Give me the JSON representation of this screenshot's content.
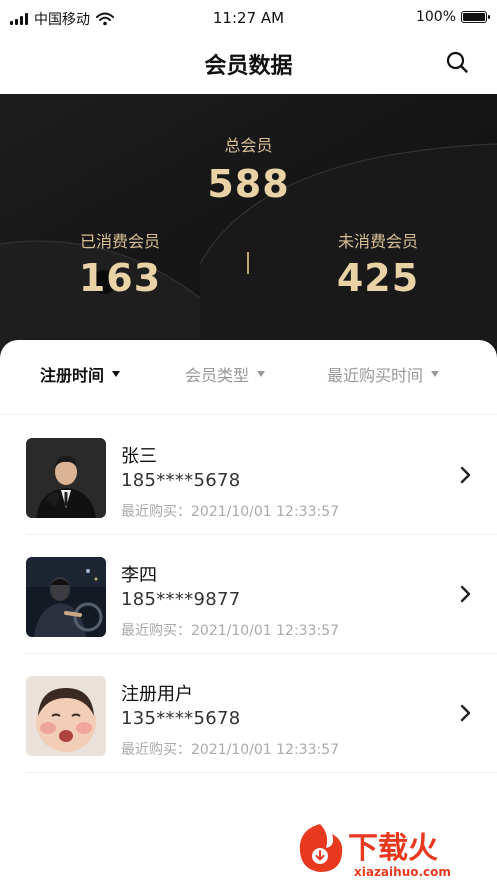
{
  "status_bar": {
    "carrier": "中国移动",
    "time": "11:27 AM",
    "battery": "100%",
    "battery_level": 1.0
  },
  "nav": {
    "title": "会员数据",
    "search_icon": "search-icon"
  },
  "stats": {
    "total_label": "总会员",
    "total_value": "588",
    "spent_label": "已消费会员",
    "spent_value": "163",
    "unspent_label": "未消费会员",
    "unspent_value": "425"
  },
  "filters": [
    {
      "label": "注册时间",
      "active": true
    },
    {
      "label": "会员类型",
      "active": false
    },
    {
      "label": "最近购买时间",
      "active": false
    }
  ],
  "members": [
    {
      "name": "张三",
      "phone": "185****5678",
      "recent": "最近购买：2021/10/01 12:33:57"
    },
    {
      "name": "李四",
      "phone": "185****9877",
      "recent": "最近购买：2021/10/01 12:33:57"
    },
    {
      "name": "注册用户",
      "phone": "135****5678",
      "recent": "最近购买：2021/10/01 12:33:57"
    }
  ],
  "watermark": {
    "text": "下载火",
    "url_text": "xiazaihuo.com"
  },
  "colors": {
    "hero_bg": "#161616",
    "gold": "#e9d2a6",
    "watermark_red": "#e8391f"
  }
}
